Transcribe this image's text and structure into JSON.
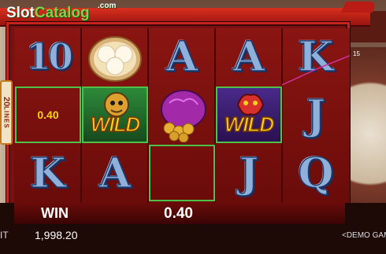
{
  "branding": {
    "logo_slot": "Slot",
    "logo_catalog": "Catalog",
    "logo_com": ".com"
  },
  "lines": {
    "count": "20",
    "label": "LINES"
  },
  "reels": [
    [
      "10",
      "bao-buns-symbol",
      "K"
    ],
    [
      "A",
      "win-0.40",
      "A"
    ],
    [
      "A",
      "lucky-bag-symbol",
      "win-empty"
    ],
    [
      "A",
      "WILD",
      "J"
    ],
    [
      "K",
      "J",
      "Q"
    ]
  ],
  "cells": {
    "r1c1": "10",
    "r1c3": "K",
    "r2c1": "A",
    "r2c3": "A",
    "r3c1": "A",
    "r4c1": "A",
    "r4c3": "J",
    "r5c1": "K",
    "r5c2": "J",
    "r5c3": "Q",
    "r1c2_win": "0.40",
    "wild_label": "WILD"
  },
  "payline": {
    "number": "15"
  },
  "win": {
    "label": "WIN",
    "amount": "0.40"
  },
  "credit": {
    "label": "IT",
    "amount": "1,998.20"
  },
  "mode": {
    "label": "<DEMO GAM"
  }
}
